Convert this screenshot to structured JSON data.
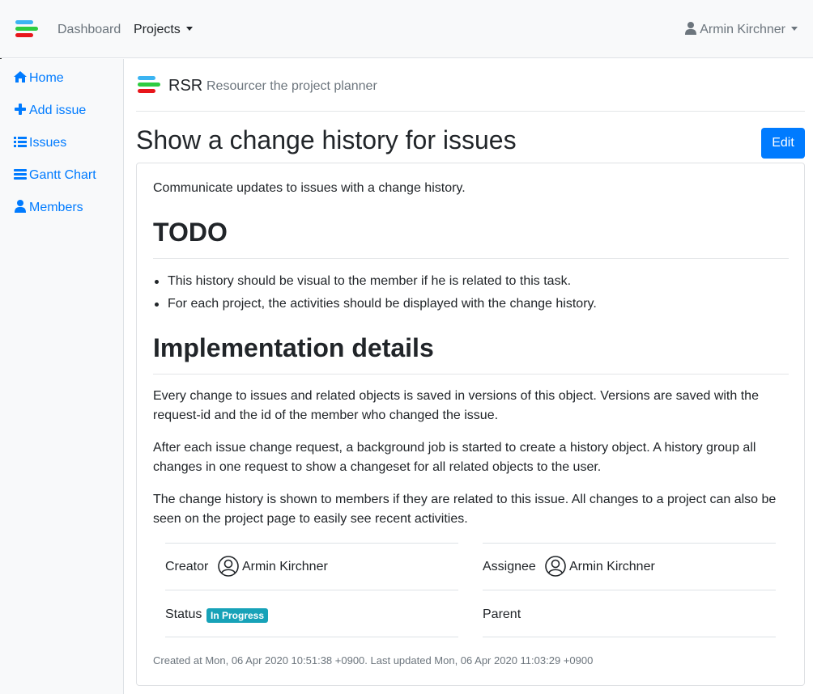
{
  "navbar": {
    "dashboard_label": "Dashboard",
    "projects_label": "Projects",
    "user_label": "Armin Kirchner"
  },
  "sidebar": {
    "items": [
      {
        "label": "Home",
        "icon": "home-icon"
      },
      {
        "label": "Add issue",
        "icon": "plus-icon"
      },
      {
        "label": "Issues",
        "icon": "list-icon"
      },
      {
        "label": "Gantt Chart",
        "icon": "bars-icon"
      },
      {
        "label": "Members",
        "icon": "user-icon"
      }
    ]
  },
  "header": {
    "app_name": "RSR",
    "app_subtitle": "Resourcer the project planner"
  },
  "issue": {
    "title": "Show a change history for issues",
    "edit_label": "Edit",
    "intro": "Communicate updates to issues with a change history.",
    "todo_heading": "TODO",
    "todo_items": [
      "This history should be visual to the member if he is related to this task.",
      "For each project, the activities should be displayed with the change history."
    ],
    "impl_heading": "Implementation details",
    "paragraphs": [
      "Every change to issues and related objects is saved in versions of this object. Versions are saved with the request-id and the id of the member who changed the issue.",
      "After each issue change request, a background job is started to create a history object. A history group all changes in one request to show a changeset for all related objects to the user.",
      "The change history is shown to members if they are related to this issue. All changes to a project can also be seen on the project page to easily see recent activities."
    ],
    "meta": {
      "creator_label": "Creator",
      "creator_name": "Armin Kirchner",
      "assignee_label": "Assignee",
      "assignee_name": "Armin Kirchner",
      "status_label": "Status",
      "status_badge": "In Progress",
      "parent_label": "Parent"
    },
    "footer": "Created at Mon, 06 Apr 2020 10:51:38 +0900. Last updated Mon, 06 Apr 2020 11:03:29 +0900"
  },
  "colors": {
    "primary": "#007bff",
    "logo_blue": "#3bb4f2",
    "logo_green": "#2ecc40",
    "logo_red": "#e8161b",
    "badge_info": "#17a2b8"
  }
}
